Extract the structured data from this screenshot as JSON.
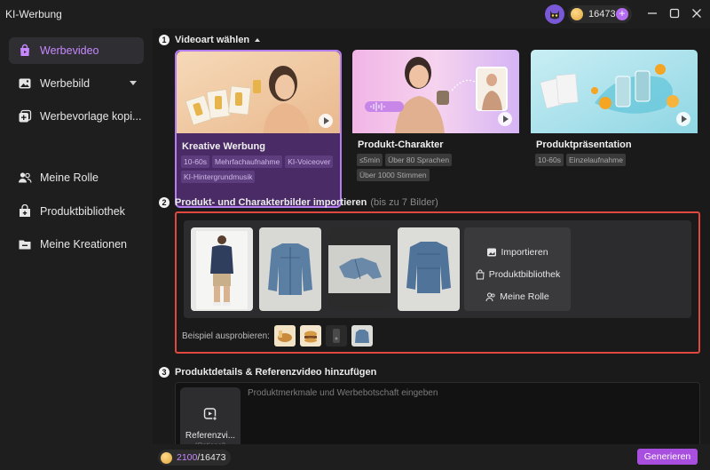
{
  "app": {
    "title": "KI-Werbung"
  },
  "header": {
    "credits": "16473",
    "plus": "+"
  },
  "colors": {
    "accent": "#b46cf0",
    "highlight_border": "#e0473f",
    "active_card": "#4a2b66"
  },
  "sidebar": {
    "items": [
      {
        "label": "Werbevideo",
        "icon": "bag-icon",
        "active": true
      },
      {
        "label": "Werbebild",
        "icon": "image-icon",
        "active": false
      },
      {
        "label": "Werbevorlage kopi...",
        "icon": "copy-plus-icon",
        "active": false
      },
      {
        "label": "Meine Rolle",
        "icon": "users-icon",
        "active": false
      },
      {
        "label": "Produktbibliothek",
        "icon": "box-plus-icon",
        "active": false
      },
      {
        "label": "Meine Kreationen",
        "icon": "folder-icon",
        "active": false
      }
    ]
  },
  "step1": {
    "number": "1",
    "title": "Videoart wählen",
    "cards": [
      {
        "title": "Kreative Werbung",
        "tags": [
          "10-60s",
          "Mehrfachaufnahme",
          "KI-Voiceover",
          "KI-Hintergrundmusik"
        ]
      },
      {
        "title": "Produkt-Charakter",
        "tags": [
          "≤5min",
          "Über 80 Sprachen",
          "Über 1000 Stimmen"
        ]
      },
      {
        "title": "Produktpräsentation",
        "tags": [
          "10-60s",
          "Einzelaufnahme"
        ]
      }
    ]
  },
  "step2": {
    "number": "2",
    "title": "Produkt- und Charakterbilder importieren",
    "subtitle": "(bis zu 7 Bilder)",
    "actions": {
      "import": "Importieren",
      "library": "Produktbibliothek",
      "role": "Meine Rolle"
    },
    "sample_label": "Beispiel ausprobieren:"
  },
  "step3": {
    "number": "3",
    "title": "Produktdetails & Referenzvideo hinzufügen",
    "ref_label": "Referenzvi...",
    "ref_sub": "(Optional)",
    "placeholder": "Produktmerkmale und Werbebotschaft eingeben"
  },
  "bottom": {
    "used": "2100",
    "total": "/16473",
    "generate": "Generieren"
  }
}
